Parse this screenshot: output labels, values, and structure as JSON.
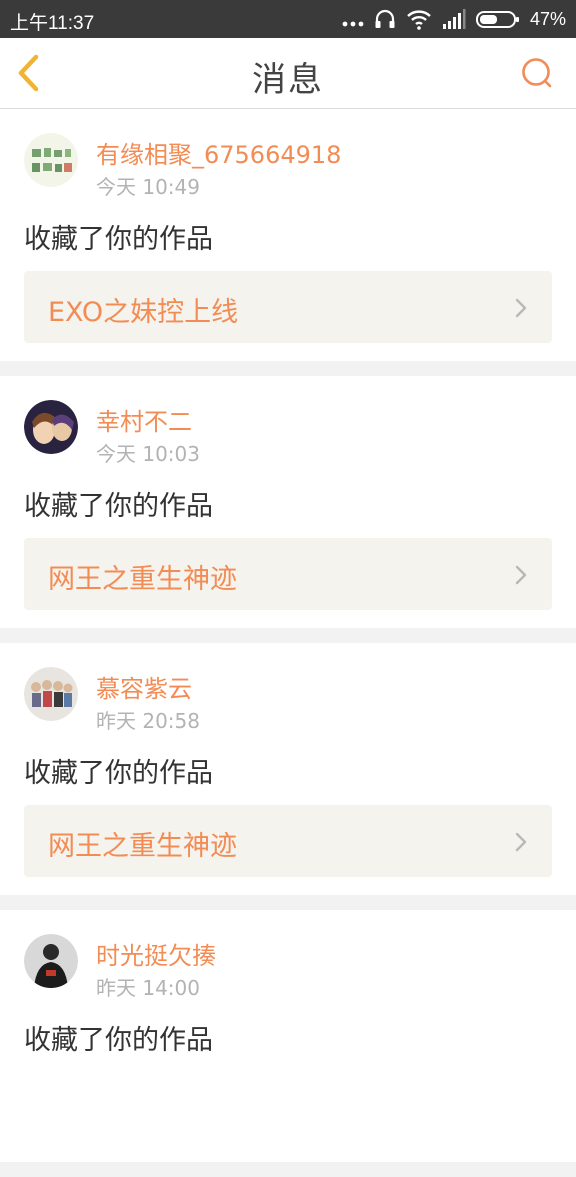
{
  "status_bar": {
    "time": "上午11:37",
    "battery": "47%",
    "icons": [
      "dots-icon",
      "headset-icon",
      "wifi-icon",
      "signal-icon",
      "battery-icon"
    ]
  },
  "header": {
    "title": "消息",
    "back_icon": "chevron-left-icon",
    "search_icon": "search-icon"
  },
  "colors": {
    "accent": "#f28c54",
    "back": "#f2b233",
    "status_bar": "#3a3a3a"
  },
  "messages": [
    {
      "user": "有缘相聚_675664918",
      "time": "今天 10:49",
      "action": "收藏了你的作品",
      "work": "EXO之妹控上线"
    },
    {
      "user": "幸村不二",
      "time": "今天 10:03",
      "action": "收藏了你的作品",
      "work": "网王之重生神迹"
    },
    {
      "user": "慕容紫云",
      "time": "昨天 20:58",
      "action": "收藏了你的作品",
      "work": "网王之重生神迹"
    },
    {
      "user": "时光挺欠揍",
      "time": "昨天 14:00",
      "action": "收藏了你的作品",
      "work": ""
    }
  ]
}
